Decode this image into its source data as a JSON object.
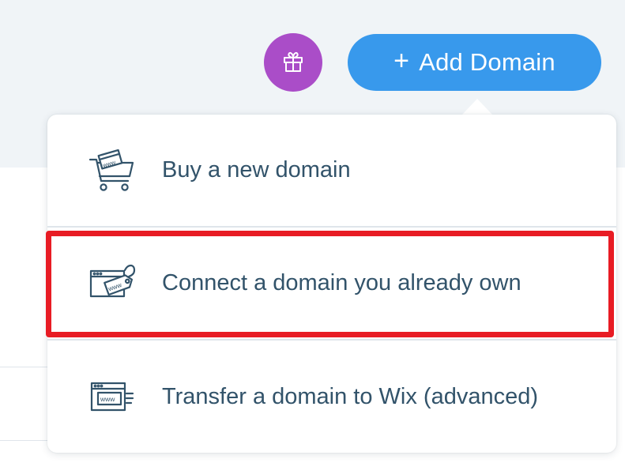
{
  "header": {
    "gift_icon": "gift-icon",
    "add_button": {
      "icon": "plus-icon",
      "plus_glyph": "+",
      "label": "Add Domain"
    }
  },
  "dropdown": {
    "options": [
      {
        "label": "Buy a new domain",
        "icon": "shopping-cart-icon"
      },
      {
        "label": "Connect a domain you already own",
        "icon": "domain-tag-icon"
      },
      {
        "label": "Transfer a domain to Wix (advanced)",
        "icon": "browser-transfer-icon"
      }
    ]
  },
  "colors": {
    "accent": "#3899ec",
    "gift": "#aa4dc8",
    "text": "#32536a",
    "highlight": "#e81c24"
  }
}
